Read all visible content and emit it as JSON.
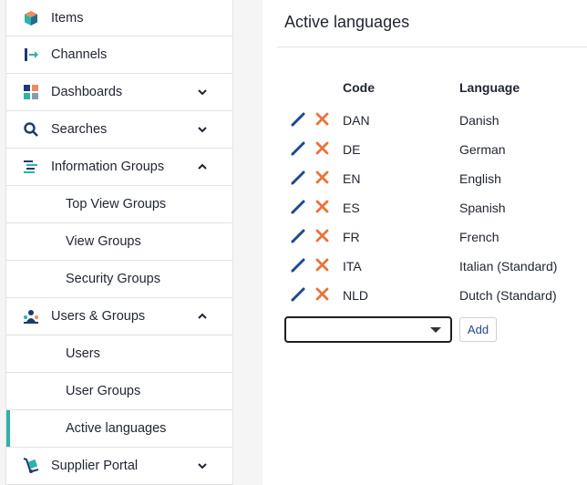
{
  "sidebar": {
    "items": [
      {
        "label": "Items",
        "icon": "cube-icon",
        "chevron": ""
      },
      {
        "label": "Channels",
        "icon": "channel-arrow-icon",
        "chevron": ""
      },
      {
        "label": "Dashboards",
        "icon": "dashboard-grid-icon",
        "chevron": "down"
      },
      {
        "label": "Searches",
        "icon": "search-icon",
        "chevron": "down"
      },
      {
        "label": "Information Groups",
        "icon": "list-icon",
        "chevron": "up"
      },
      {
        "label": "Top View Groups",
        "sub": true
      },
      {
        "label": "View Groups",
        "sub": true
      },
      {
        "label": "Security Groups",
        "sub": true
      },
      {
        "label": "Users & Groups",
        "icon": "users-icon",
        "chevron": "up"
      },
      {
        "label": "Users",
        "sub": true
      },
      {
        "label": "User Groups",
        "sub": true
      },
      {
        "label": "Active languages",
        "sub": true,
        "active": true
      },
      {
        "label": "Supplier Portal",
        "icon": "hand-truck-icon",
        "chevron": "down"
      }
    ]
  },
  "main": {
    "title": "Active languages",
    "columns": {
      "code": "Code",
      "language": "Language"
    },
    "rows": [
      {
        "code": "DAN",
        "language": "Danish"
      },
      {
        "code": "DE",
        "language": "German"
      },
      {
        "code": "EN",
        "language": "English"
      },
      {
        "code": "ES",
        "language": "Spanish"
      },
      {
        "code": "FR",
        "language": "French"
      },
      {
        "code": "ITA",
        "language": "Italian (Standard)"
      },
      {
        "code": "NLD",
        "language": "Dutch (Standard)"
      }
    ],
    "select_value": "",
    "add_label": "Add"
  },
  "colors": {
    "accent": "#2fb3a6",
    "edit_icon": "#1e4a8c",
    "delete_icon": "#e8743b"
  }
}
